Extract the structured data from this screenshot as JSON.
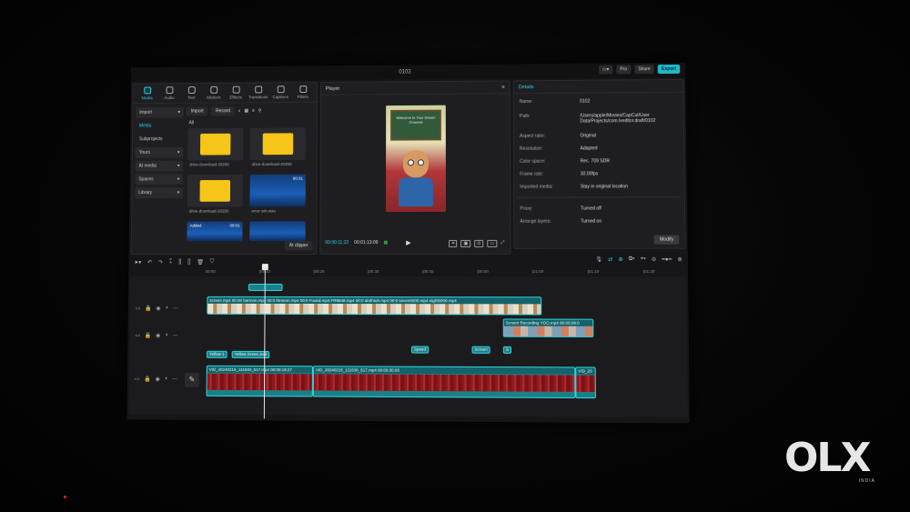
{
  "window": {
    "title": "0102",
    "pro": "Pro",
    "share": "Share",
    "export": "Export"
  },
  "toolbar": {
    "items": [
      "Media",
      "Audio",
      "Text",
      "Stickers",
      "Effects",
      "Transitions",
      "Captions",
      "Filters"
    ]
  },
  "media": {
    "side": [
      "Import",
      "Media",
      "Subprojects",
      "Yours",
      "AI media",
      "Spaces",
      "Library"
    ],
    "import_btn": "Import",
    "record_btn": "Record",
    "all_label": "All",
    "tiles": [
      "drive-download-20250",
      "drive-download-20250",
      "drive-download-20250",
      "error win.wav"
    ],
    "wave_duration": "00:31",
    "added_label": "Added",
    "added_duration": "00:01",
    "ai_clipper": "AI clipper"
  },
  "player": {
    "title": "Player",
    "board_text": "Welcome to Your Dream Channel",
    "current_time": "00:00:11:22",
    "total_time": "00:01:13:09"
  },
  "details": {
    "title": "Details",
    "rows": [
      {
        "label": "Name:",
        "value": "0102"
      },
      {
        "label": "Path:",
        "value": "/Users/apple/Movies/CapCut/User Data/Projects/com.lveditor.draft/0102"
      },
      {
        "label": "Aspect ratio:",
        "value": "Original"
      },
      {
        "label": "Resolution:",
        "value": "Adapted"
      },
      {
        "label": "Color space:",
        "value": "Rec. 709 SDR"
      },
      {
        "label": "Frame rate:",
        "value": "30.00fps"
      },
      {
        "label": "Imported media:",
        "value": "Stay in original location"
      },
      {
        "label": "Proxy:",
        "value": "Turned off"
      },
      {
        "label": "Arrange layers:",
        "value": "Turned on"
      }
    ],
    "modify": "Modify"
  },
  "timeline": {
    "ruler": [
      "00:00",
      "|00:10",
      "|00:20",
      "|00:30",
      "|00:40",
      "|00:50",
      "|01:00",
      "|01:10",
      "|01:20"
    ],
    "top_clips": [
      "screen.mp4",
      "00:00",
      "harmon.mp4",
      "00:0",
      "threeon.mp4",
      "00:0",
      "Found.mp4",
      "FR8848.mp4",
      "00:0",
      "ab0htuh.mp4",
      "00:0",
      "seven5000.mp4",
      "eight5000.mp4"
    ],
    "screen_rec": "Screen Recording",
    "yoo": "YOO.mp4  00:00:09:0",
    "tags": [
      "Yellow-1",
      "Yellow Green Zolli",
      "Speed",
      "Screen",
      "S"
    ],
    "main1": "VID_20240215_111530_517.mp4  00:00:19:27",
    "main2": "VID_20240215_111530_517.mp4  00:00:30:03",
    "main3": "VID_20"
  },
  "watermark": {
    "brand": "OLX",
    "country": "INDIA"
  }
}
